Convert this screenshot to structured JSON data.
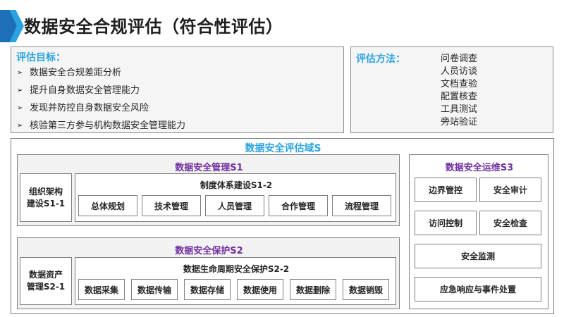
{
  "title": "数据安全合规评估（符合性评估）",
  "goals": {
    "label": "评估目标：",
    "items": [
      "数据安全合规差距分析",
      "提升自身数据安全管理能力",
      "发现并防控自身数据安全风险",
      "核验第三方参与机构数据安全管理能力"
    ]
  },
  "methods": {
    "label": "评估方法：",
    "items": [
      "问卷调查",
      "人员访谈",
      "文档查验",
      "配置核查",
      "工具测试",
      "旁站验证"
    ]
  },
  "domain": {
    "title": "数据安全评估域S",
    "s1": {
      "title": "数据安全管理S1",
      "left": "组织架构\n建设S1-1",
      "sub_title": "制度体系建设S1-2",
      "items": [
        "总体规划",
        "技术管理",
        "人员管理",
        "合作管理",
        "流程管理"
      ]
    },
    "s2": {
      "title": "数据安全保护S2",
      "left": "数据资产\n管理S2-1",
      "sub_title": "数据生命周期安全保护S2-2",
      "items": [
        "数据采集",
        "数据传输",
        "数据存储",
        "数据使用",
        "数据删除",
        "数据销毁"
      ]
    },
    "s3": {
      "title": "数据安全运维S3",
      "items": [
        "边界管控",
        "安全审计",
        "访问控制",
        "安全检查",
        "安全监测",
        "应急响应与事件处置"
      ]
    }
  }
}
